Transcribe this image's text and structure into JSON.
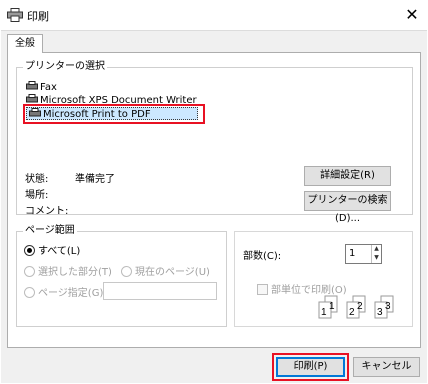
{
  "window": {
    "title": "印刷",
    "close_label": "✕"
  },
  "tabs": [
    {
      "label": "全般"
    }
  ],
  "printer_group": {
    "title": "プリンターの選択",
    "printers": [
      {
        "label": "Fax",
        "selected": false
      },
      {
        "label": "Microsoft XPS Document Writer",
        "selected": false
      },
      {
        "label": "Microsoft Print to PDF",
        "selected": true
      }
    ],
    "status_label": "状態:",
    "status_value": "準備完了",
    "location_label": "場所:",
    "comment_label": "コメント:",
    "preferences_button": "詳細設定(R)",
    "find_printer_button": "プリンターの検索(D)..."
  },
  "page_range": {
    "title": "ページ範囲",
    "all_label": "すべて(L)",
    "selection_label": "選択した部分(T)",
    "current_page_label": "現在のページ(U)",
    "pages_label": "ページ指定(G):",
    "pages_value": ""
  },
  "copies": {
    "label": "部数(C):",
    "value": "1",
    "collate_label": "部単位で印刷(O)",
    "collate_checked": false,
    "collate_icon_numbers": [
      "1",
      "1",
      "2",
      "2",
      "3",
      "3"
    ]
  },
  "footer": {
    "print_button": "印刷(P)",
    "cancel_button": "キャンセル"
  },
  "colors": {
    "highlight": "#e81123",
    "selection": "#cce8ff",
    "accent": "#0078d7"
  }
}
